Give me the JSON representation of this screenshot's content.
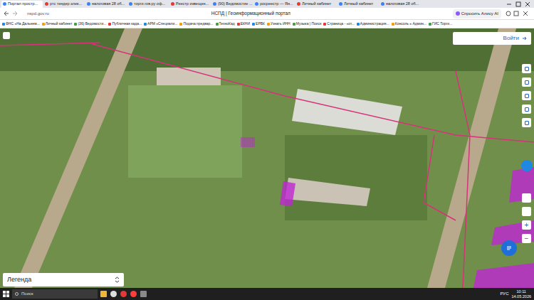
{
  "browser": {
    "tabs": [
      {
        "label": "Портал простр...",
        "selected": true
      },
      {
        "label": "ртс тендер элек...",
        "selected": false
      },
      {
        "label": "налоговая 28 об...",
        "selected": false
      },
      {
        "label": "торги.гов.ру оф...",
        "selected": false
      },
      {
        "label": "Реестр извещен...",
        "selected": false
      },
      {
        "label": "(90) Ведомостие ...",
        "selected": false
      },
      {
        "label": "росреестр — Ян...",
        "selected": false
      },
      {
        "label": "Личный кабинет",
        "selected": false
      },
      {
        "label": "Личный кабинет",
        "selected": false
      },
      {
        "label": "налоговая 28 об...",
        "selected": false
      }
    ],
    "address": "nspd.gov.ru",
    "page_title": "НСПД | Геоинформационный портал",
    "alice": "Спросить Алису AI"
  },
  "bookmarks": [
    "ФНС «На Дальнем...",
    "Личный кабинет",
    "(36) Ведомости...",
    "Публичная када...",
    "АРМ «Специали...",
    "Подача предвар...",
    "ТехноКад",
    "ЕКНИ",
    "ЕРВК",
    "Узнать ИНН",
    "Музыка | Поиск",
    "Страница - «от...",
    "Администрация...",
    "Консоль « Админ...",
    "ГИС Торги..."
  ],
  "map": {
    "login": "Войти",
    "legend": "Легенда",
    "zoom_in": "+",
    "zoom_out": "−"
  },
  "taskbar": {
    "search": "Поиск",
    "lang": "РУС",
    "time": "10:11",
    "date": "14.05.2026"
  }
}
